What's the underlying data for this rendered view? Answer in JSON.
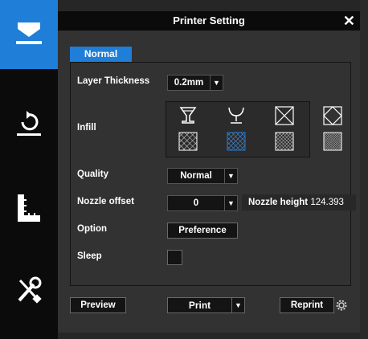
{
  "toolbar": {
    "items": [
      {
        "name": "print-settings",
        "active": true
      },
      {
        "name": "reset"
      },
      {
        "name": "measure"
      },
      {
        "name": "tools"
      }
    ]
  },
  "dialog": {
    "title": "Printer Setting",
    "close_glyph": "✕",
    "tab_label": "Normal",
    "layer_thickness": {
      "label": "Layer Thickness",
      "value": "0.2mm"
    },
    "infill": {
      "label": "Infill",
      "selected_index": 5
    },
    "quality": {
      "label": "Quality",
      "value": "Normal"
    },
    "nozzle_offset": {
      "label": "Nozzle offset",
      "value": "0"
    },
    "nozzle_height": {
      "label": "Nozzle height",
      "value": "124.393"
    },
    "option": {
      "label": "Option",
      "button": "Preference"
    },
    "sleep": {
      "label": "Sleep",
      "checked": false
    },
    "buttons": {
      "preview": "Preview",
      "print": "Print",
      "reprint": "Reprint"
    },
    "dropdown_arrow": "▼"
  },
  "colors": {
    "accent": "#1e7ed8",
    "dark": "#0b0b0b",
    "panel": "#323232"
  }
}
